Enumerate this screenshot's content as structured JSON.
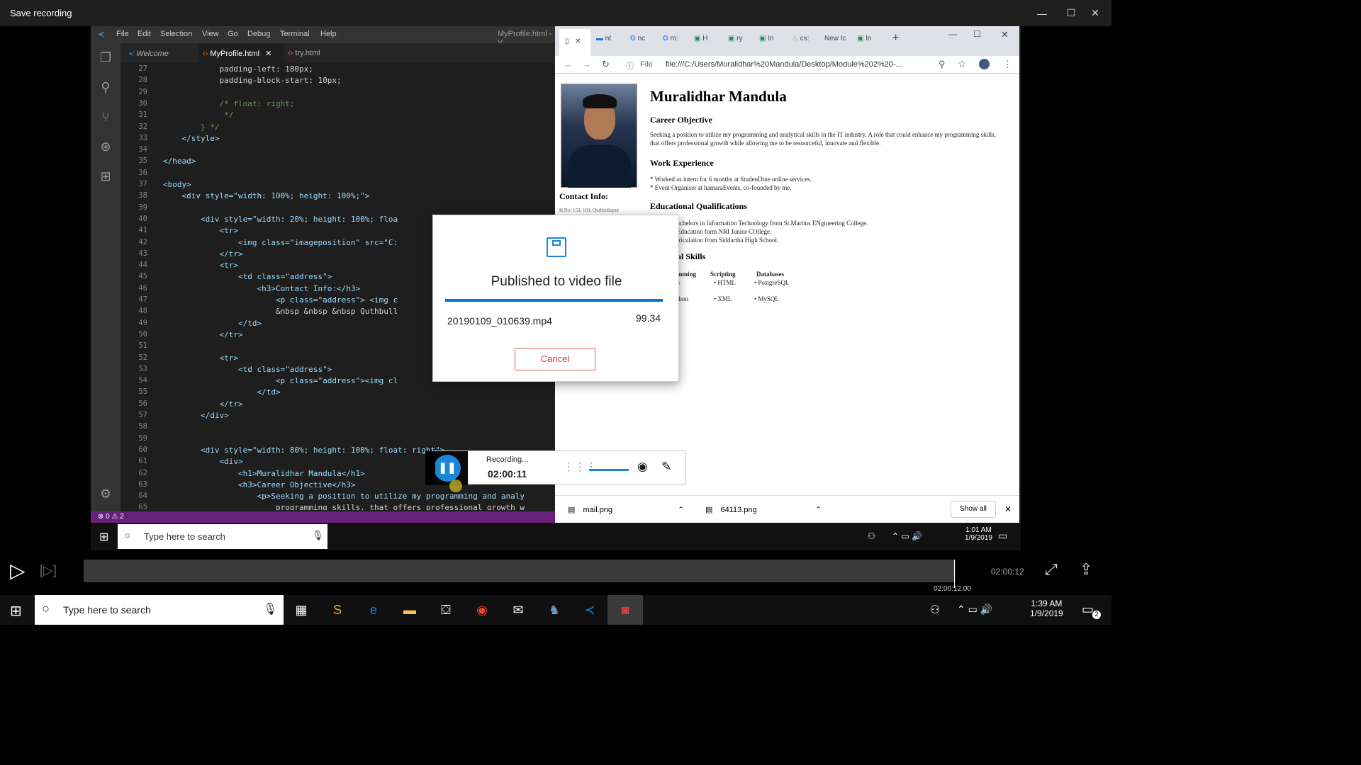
{
  "window": {
    "title": "Save recording"
  },
  "vscode": {
    "menu": [
      "File",
      "Edit",
      "Selection",
      "View",
      "Go",
      "Debug",
      "Terminal",
      "Help"
    ],
    "title": "MyProfile.html - V",
    "tabs": [
      "Welcome",
      "MyProfile.html",
      "try.html"
    ],
    "lines": [
      {
        "n": "27",
        "t": "            padding-left: 180px;"
      },
      {
        "n": "28",
        "t": "            padding-block-start: 10px;"
      },
      {
        "n": "29",
        "t": ""
      },
      {
        "n": "30",
        "t": "            /* float: right;"
      },
      {
        "n": "31",
        "t": "             */"
      },
      {
        "n": "32",
        "t": "        } */"
      },
      {
        "n": "33",
        "t": "    </style>"
      },
      {
        "n": "34",
        "t": ""
      },
      {
        "n": "35",
        "t": "</head>"
      },
      {
        "n": "36",
        "t": ""
      },
      {
        "n": "37",
        "t": "<body>"
      },
      {
        "n": "38",
        "t": "    <div style=\"width: 100%; height: 100%;\">"
      },
      {
        "n": "39",
        "t": ""
      },
      {
        "n": "40",
        "t": "        <div style=\"width: 20%; height: 100%; floa"
      },
      {
        "n": "41",
        "t": "            <tr>"
      },
      {
        "n": "42",
        "t": "                <img class=\"imageposition\" src=\"C:"
      },
      {
        "n": "43",
        "t": "            </tr>"
      },
      {
        "n": "44",
        "t": "            <tr>"
      },
      {
        "n": "45",
        "t": "                <td class=\"address\">"
      },
      {
        "n": "46",
        "t": "                    <h3>Contact Info:</h3>"
      },
      {
        "n": "47",
        "t": "                        <p class=\"address\"> <img c"
      },
      {
        "n": "48",
        "t": "                        &nbsp &nbsp &nbsp Quthbull"
      },
      {
        "n": "49",
        "t": "                </td>"
      },
      {
        "n": "50",
        "t": "            </tr>"
      },
      {
        "n": "51",
        "t": ""
      },
      {
        "n": "52",
        "t": "            <tr>"
      },
      {
        "n": "53",
        "t": "                <td class=\"address\">"
      },
      {
        "n": "54",
        "t": "                        <p class=\"address\"><img cl"
      },
      {
        "n": "55",
        "t": "                    </td>"
      },
      {
        "n": "56",
        "t": "            </tr>"
      },
      {
        "n": "57",
        "t": "        </div>"
      },
      {
        "n": "58",
        "t": ""
      },
      {
        "n": "59",
        "t": ""
      },
      {
        "n": "60",
        "t": "        <div style=\"width: 80%; height: 100%; float: right\">"
      },
      {
        "n": "61",
        "t": "            <div>"
      },
      {
        "n": "62",
        "t": "                <h1>Muralidhar Mandula</h1>"
      },
      {
        "n": "63",
        "t": "                <h3>Career Objective</h3>"
      },
      {
        "n": "64",
        "t": "                    <p>Seeking a position to utilize my programming and analy"
      },
      {
        "n": "65",
        "t": "                        programming skills, that offers professional growth w"
      }
    ],
    "status": "⊗ 0 ⚠ 2"
  },
  "chrome": {
    "tabs": [
      "nt",
      "nc",
      "m:",
      "H",
      "ry",
      "In",
      "cs:",
      "New Ic",
      "In"
    ],
    "url": "file:///C:/Users/Muralidhar%20Mandula/Desktop/Module%202%20-...",
    "url_prefix": "File",
    "page": {
      "name": "Muralidhar Mandula",
      "contact_heading": "Contact Info:",
      "address_snippet": "H.No: 153, 169, Quthbullapur",
      "career_heading": "Career Objective",
      "career_text": "Seeking a position to utilize my programming and analytical skills in the IT industry. A role that could enhance my programming skills, that offers professional growth while allowing me to be resourceful, innovate and flexible.",
      "work_heading": "Work Experience",
      "work_items": [
        "* Worked as intern for 6 months at StudenDine online services.",
        "* Event Organiser at hamaraEvents, co-founded by me."
      ],
      "edu_heading": "Educational Qualifications",
      "edu_items": [
        "achelors in Information Technology from St.Martins ENgineering College.",
        "Education form NRI Junior COllege.",
        "triculation from Siddartha High School."
      ],
      "skills_heading": "al Skills",
      "skill_cols": [
        "mming",
        "Scripting",
        "Databases"
      ],
      "skill_row1": [
        "a",
        "HTML",
        "PostgreSQL"
      ],
      "skill_row2": [
        "thon",
        "XML",
        "MySQL"
      ]
    },
    "downloads": [
      "mail.png",
      "64113.png"
    ],
    "show_all": "Show all"
  },
  "video_taskbar": {
    "search_placeholder": "Type here to search",
    "time": "1:01 AM",
    "date": "1/9/2019"
  },
  "dialog": {
    "title": "Published to video file",
    "file": "20190109_010639.mp4",
    "percent": "99.34",
    "progress": 0.9934,
    "cancel": "Cancel"
  },
  "recorder": {
    "status": "Recording...",
    "time": "02:00:11"
  },
  "player": {
    "time": "02:00:12",
    "marker": "02:00:12.00",
    "progress": 0.998
  },
  "taskbar": {
    "search_placeholder": "Type here to search",
    "time": "1:39 AM",
    "date": "1/9/2019",
    "notif_count": "2"
  }
}
